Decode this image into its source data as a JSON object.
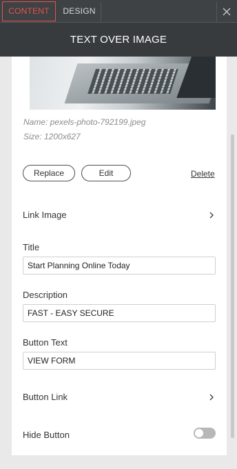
{
  "tabs": {
    "content": "CONTENT",
    "design": "DESIGN"
  },
  "header": {
    "title": "TEXT OVER IMAGE"
  },
  "image": {
    "name": "Name: pexels-photo-792199.jpeg",
    "size": "Size: 1200x627"
  },
  "actions": {
    "replace": "Replace",
    "edit": "Edit",
    "delete": "Delete"
  },
  "link_image": {
    "label": "Link Image"
  },
  "title_field": {
    "label": "Title",
    "value": "Start Planning Online Today"
  },
  "description_field": {
    "label": "Description",
    "value": "FAST - EASY SECURE"
  },
  "button_text_field": {
    "label": "Button Text",
    "value": "VIEW FORM"
  },
  "button_link": {
    "label": "Button Link"
  },
  "hide_button": {
    "label": "Hide Button",
    "enabled": false
  },
  "colors": {
    "accent": "#e8534a",
    "header_bg": "#373b3e"
  },
  "icons": [
    "close-icon",
    "chevron-right-icon"
  ]
}
